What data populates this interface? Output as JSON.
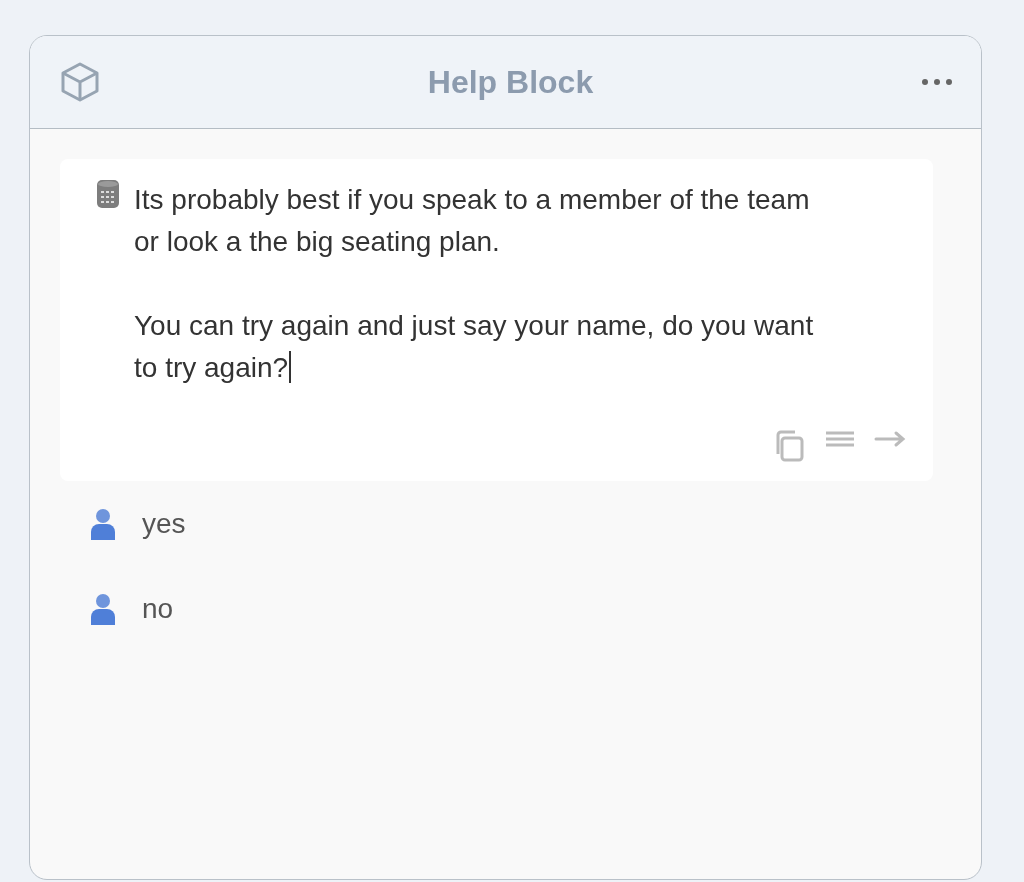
{
  "window": {
    "title": "Help Block"
  },
  "message": {
    "paragraphs": [
      "Its probably best if you speak to a member of the team or look a the big seating plan.",
      "You can try again and just say your name, do you want to try again?"
    ],
    "editing": true
  },
  "replies": [
    {
      "text": "yes"
    },
    {
      "text": "no"
    }
  ]
}
